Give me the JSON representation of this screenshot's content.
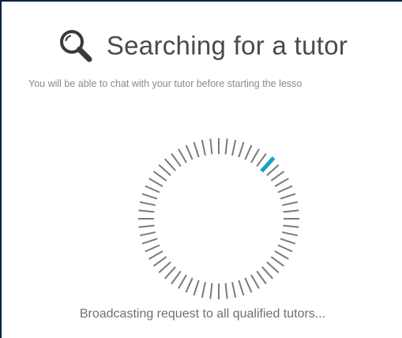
{
  "header": {
    "title": "Searching for a tutor",
    "icon": "search-icon"
  },
  "subtitle": "You will be able to chat with your tutor before starting the lesso",
  "spinner": {
    "tick_count": 60,
    "active_tick_index": 7,
    "tick_color": "#7a7a7a",
    "active_color": "#1aa0c8"
  },
  "status": "Broadcasting request to all qualified tutors..."
}
